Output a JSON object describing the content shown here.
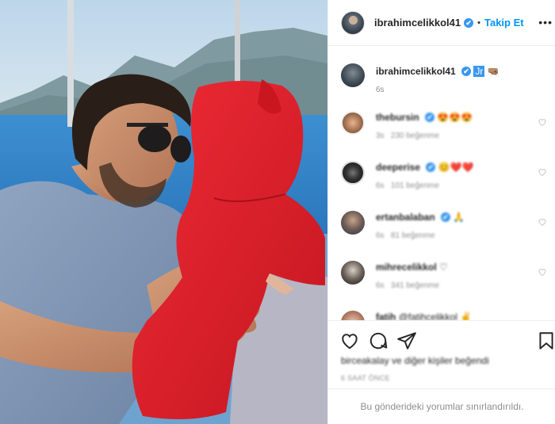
{
  "post": {
    "image_alt": "photo-man-with-baby-on-boat"
  },
  "header": {
    "username": "ibrahimcelikkol41",
    "verified_mark": "✔",
    "separator": "•",
    "follow_label": "Takip Et",
    "more_label": "•••"
  },
  "caption": {
    "username": "ibrahimcelikkol41",
    "verified_mark": "✔",
    "tag": "Jr",
    "emoji": "🤜🏽",
    "time": "6s"
  },
  "comments": [
    {
      "username": "thebursin",
      "verified": true,
      "text": "😍😍😍",
      "time": "3s",
      "likes": "230 beğenme"
    },
    {
      "username": "deeperise",
      "verified": true,
      "text": "😊❤️❤️",
      "time": "6s",
      "likes": "101 beğenme"
    },
    {
      "username": "ertanbalaban",
      "verified": true,
      "text": "🙏",
      "time": "6s",
      "likes": "81 beğenme"
    },
    {
      "username": "mihrecelikkol",
      "verified": false,
      "text": "♡",
      "time": "6s",
      "likes": "341 beğenme"
    },
    {
      "username": "fatih",
      "verified": false,
      "text": "@fatihcelikkol ✌",
      "time": "",
      "likes": ""
    }
  ],
  "footer": {
    "likes_text": "birceakalay ve diğer kişiler beğendi",
    "time_ago": "6 SAAT ÖNCE",
    "restricted_text": "Bu gönderideki yorumlar sınırlandırıldı."
  },
  "colors": {
    "accent": "#0095f6",
    "verified": "#3897f0",
    "heart_red": "#ed4956",
    "muted": "#8e8e8e"
  }
}
